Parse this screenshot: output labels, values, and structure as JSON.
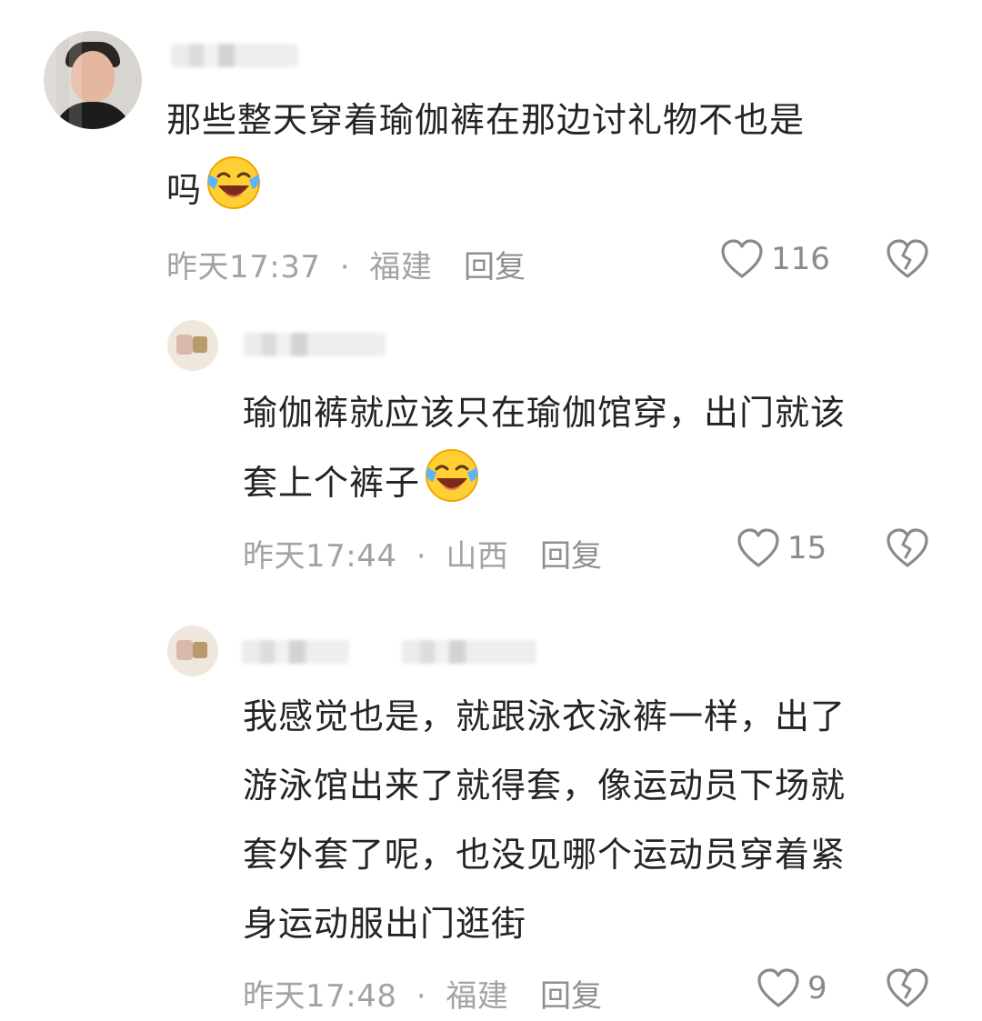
{
  "comments": [
    {
      "text_line1": "那些整天穿着瑜伽裤在那边讨礼物不也是",
      "text_line2": "吗",
      "emoji": "laughing-crying-emoji",
      "time": "昨天17:37",
      "separator": "·",
      "location": "福建",
      "reply_label": "回复",
      "likes": "116"
    },
    {
      "text_line1": "瑜伽裤就应该只在瑜伽馆穿，出门就该",
      "text_line2": "套上个裤子",
      "emoji": "laughing-crying-emoji",
      "time": "昨天17:44",
      "separator": "·",
      "location": "山西",
      "reply_label": "回复",
      "likes": "15"
    },
    {
      "text_line1": "我感觉也是，就跟泳衣泳裤一样，出了",
      "text_line2": "游泳馆出来了就得套，像运动员下场就",
      "text_line3": "套外套了呢，也没见哪个运动员穿着紧",
      "text_line4": "身运动服出门逛街",
      "time": "昨天17:48",
      "separator": "·",
      "location": "福建",
      "reply_label": "回复",
      "likes": "9"
    }
  ],
  "icons": {
    "like": "heart-outline-icon",
    "dislike": "broken-heart-icon"
  },
  "colors": {
    "text": "#242424",
    "meta": "#a3a3a3",
    "icon": "#8a8a8a"
  }
}
